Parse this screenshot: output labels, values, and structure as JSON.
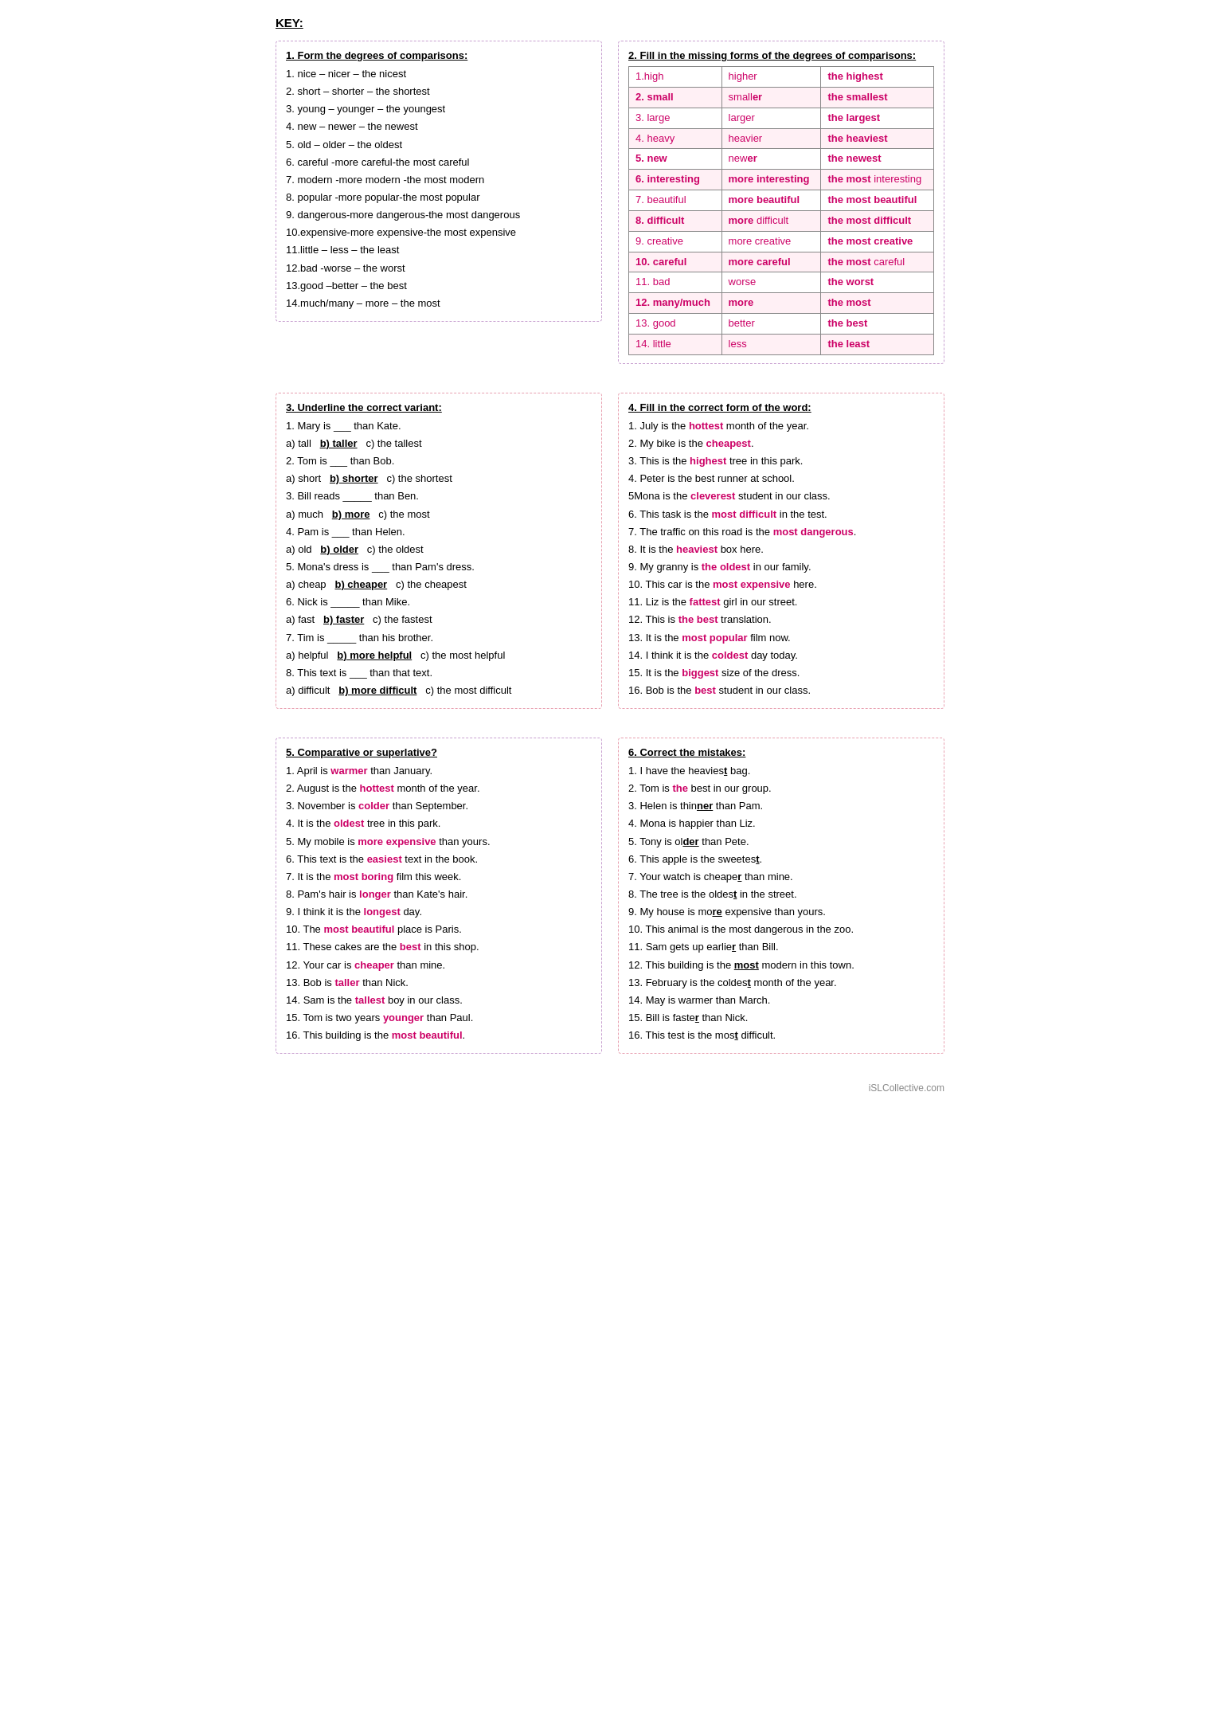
{
  "title": "KEY:",
  "section1": {
    "title": "1. Form the degrees of comparisons:",
    "lines": [
      "1. nice – nicer – the nicest",
      "2. short – shorter – the shortest",
      "3. young – younger – the youngest",
      "4. new – newer – the newest",
      "5. old – older – the oldest",
      "6. careful -more careful-the most careful",
      "7. modern -more modern -the most modern",
      "8. popular -more popular-the most popular",
      "9. dangerous-more dangerous-the most dangerous",
      "10.expensive-more expensive-the most expensive",
      "11.little – less – the least",
      "12.bad -worse – the worst",
      "13.good –better – the best",
      "14.much/many – more – the most"
    ]
  },
  "section2": {
    "title": "2. Fill in the missing forms of the degrees of comparisons:",
    "rows": [
      {
        "col1": "1.high",
        "col2": "higher",
        "col3": "the highest"
      },
      {
        "col1": "2. small",
        "col2": "smaller",
        "col3": "the smallest"
      },
      {
        "col1": "3. large",
        "col2": "larger",
        "col3": "the largest"
      },
      {
        "col1": "4. heavy",
        "col2": "heavier",
        "col3": "the heaviest"
      },
      {
        "col1": "5. new",
        "col2": "newer",
        "col3": "the newest"
      },
      {
        "col1": "6. interesting",
        "col2": "more interesting",
        "col3": "the most interesting"
      },
      {
        "col1": "7. beautiful",
        "col2": "more beautiful",
        "col3": "the most beautiful"
      },
      {
        "col1": "8. difficult",
        "col2": "more difficult",
        "col3": "the most difficult"
      },
      {
        "col1": "9. creative",
        "col2": "more creative",
        "col3": "the most creative"
      },
      {
        "col1": "10. careful",
        "col2": "more careful",
        "col3": "the most careful"
      },
      {
        "col1": "11. bad",
        "col2": "worse",
        "col3": "the worst"
      },
      {
        "col1": "12. many/much",
        "col2": "more",
        "col3": "the most"
      },
      {
        "col1": "13. good",
        "col2": "better",
        "col3": "the best"
      },
      {
        "col1": "14. little",
        "col2": "less",
        "col3": "the least"
      }
    ]
  },
  "section3": {
    "title": "3. Underline the correct variant:",
    "lines": [
      "1. Mary is ___ than Kate.",
      "a) tall   b) taller   c) the tallest",
      "2. Tom is ___ than Bob.",
      "a) short   b) shorter   c) the shortest",
      "3. Bill reads _____ than Ben.",
      "a) much   b) more   c) the most",
      "4. Pam is ___ than Helen.",
      "a) old   b) older   c) the oldest",
      "5. Mona's dress is ___ than Pam's dress.",
      "a) cheap   b) cheaper   c) the cheapest",
      "6. Nick is _____ than Mike.",
      "a) fast   b) faster   c) the fastest",
      "7. Tim is _____ than his brother.",
      "a) helpful   b) more helpful   c) the most helpful",
      "8. This text is ___ than that text.",
      "a) difficult   b) more difficult   c) the most difficult"
    ]
  },
  "section4": {
    "title": "4. Fill in the correct form of the word:",
    "lines": [
      {
        "plain": "1. July is the ",
        "colored": "hottest",
        "rest": " month of the year."
      },
      {
        "plain": "2. My bike is the ",
        "colored": "cheapest",
        "rest": "."
      },
      {
        "plain": "3. This is the ",
        "colored": "highest",
        "rest": " tree in this park."
      },
      {
        "plain": "4. Peter is the best runner at school.",
        "colored": "",
        "rest": ""
      },
      {
        "plain": "5Mona is the ",
        "colored": "cleverest",
        "rest": " student in our class."
      },
      {
        "plain": "6. This task is the ",
        "colored": "most difficult",
        "rest": " in the test."
      },
      {
        "plain": "7. The traffic on this road is the ",
        "colored": "most dangerous",
        "rest": "."
      },
      {
        "plain": "8. It is the ",
        "colored": "heaviest",
        "rest": " box here."
      },
      {
        "plain": "9. My granny is ",
        "colored": "the oldest",
        "rest": " in our family."
      },
      {
        "plain": "10. This car is the ",
        "colored": "most expensive",
        "rest": " here."
      },
      {
        "plain": "11. Liz is the ",
        "colored": "fattest",
        "rest": " girl in our street."
      },
      {
        "plain": "12. This is ",
        "colored": "the best",
        "rest": " translation."
      },
      {
        "plain": "13. It is the ",
        "colored": "most popular",
        "rest": " film now."
      },
      {
        "plain": "14. I think it is the ",
        "colored": "coldest",
        "rest": " day today."
      },
      {
        "plain": "15. It is the ",
        "colored": "biggest",
        "rest": " size of the dress."
      },
      {
        "plain": "16. Bob is the ",
        "colored": "best",
        "rest": " student in our class."
      }
    ]
  },
  "section5": {
    "title": "5. Comparative or superlative?",
    "lines": [
      {
        "plain": "1. April is ",
        "colored": "warmer",
        "rest": " than January."
      },
      {
        "plain": "2. August is the ",
        "colored": "hottest",
        "rest": " month of the year."
      },
      {
        "plain": "3. November is ",
        "colored": "colder",
        "rest": " than September."
      },
      {
        "plain": "4. It is the ",
        "colored": "oldest",
        "rest": " tree in this park."
      },
      {
        "plain": "5. My mobile is ",
        "colored": "more expensive",
        "rest": " than yours."
      },
      {
        "plain": "6. This text is the ",
        "colored": "easiest",
        "rest": " text in the book."
      },
      {
        "plain": "7. It is the ",
        "colored": "most boring",
        "rest": " film this week."
      },
      {
        "plain": "8. Pam's hair is ",
        "colored": "longer",
        "rest": " than Kate's hair."
      },
      {
        "plain": "9. I think it is the ",
        "colored": "longest",
        "rest": " day."
      },
      {
        "plain": "10. The ",
        "colored": "most beautiful",
        "rest": " place is Paris."
      },
      {
        "plain": "11. These cakes are the ",
        "colored": "best",
        "rest": " in this shop."
      },
      {
        "plain": "12. Your car is ",
        "colored": "cheaper",
        "rest": " than mine."
      },
      {
        "plain": "13. Bob is ",
        "colored": "taller",
        "rest": " than Nick."
      },
      {
        "plain": "14. Sam is the ",
        "colored": "tallest",
        "rest": " boy in our class."
      },
      {
        "plain": "15. Tom is two years ",
        "colored": "younger",
        "rest": " than Paul."
      },
      {
        "plain": "16. This building is the ",
        "colored": "most beautiful",
        "rest": "."
      }
    ]
  },
  "section6": {
    "title": "6. Correct the mistakes:",
    "lines": [
      "1. I have the heaviest bag.",
      "2. Tom is the best in our group.",
      "3. Helen is thinner than Pam.",
      "4. Mona is happier than Liz.",
      "5. Tony is older than Pete.",
      "6. This apple is the sweetest.",
      "7. Your watch is cheaper than mine.",
      "8. The tree is the oldest in the street.",
      "9. My house is more expensive than yours.",
      "10. This animal is the most dangerous in the zoo.",
      "11. Sam gets up earlier than Bill.",
      "12. This building is the most modern in this town.",
      "13. February is the coldest month of the year.",
      "14. May is warmer than March.",
      "15. Bill is faster than Nick.",
      "16. This test is the most difficult."
    ]
  },
  "watermark": "iSLCollective.com"
}
